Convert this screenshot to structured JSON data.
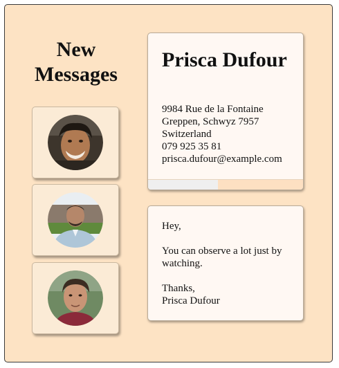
{
  "sidebar": {
    "heading": "New Messages",
    "avatars": [
      {
        "label": "sender avatar 1"
      },
      {
        "label": "sender avatar 2"
      },
      {
        "label": "sender avatar 3"
      }
    ]
  },
  "contact": {
    "name": "Prisca Dufour",
    "street": "9984 Rue de la Fontaine",
    "city_line": "Greppen, Schwyz 7957",
    "country": "Switzerland",
    "phone": "079 925 35 81",
    "email": "prisca.dufour@example.com",
    "progress_fraction": 0.45
  },
  "message": {
    "greeting": "Hey,",
    "body": "You can observe a lot just by watching.",
    "signoff": "Thanks,",
    "signature": "Prisca Dufour"
  },
  "colors": {
    "background": "#fde3c4",
    "card": "#fbebd6",
    "panel": "#fff8f3",
    "progress_track": "#fde0c2",
    "progress_fill": "#efefef"
  }
}
